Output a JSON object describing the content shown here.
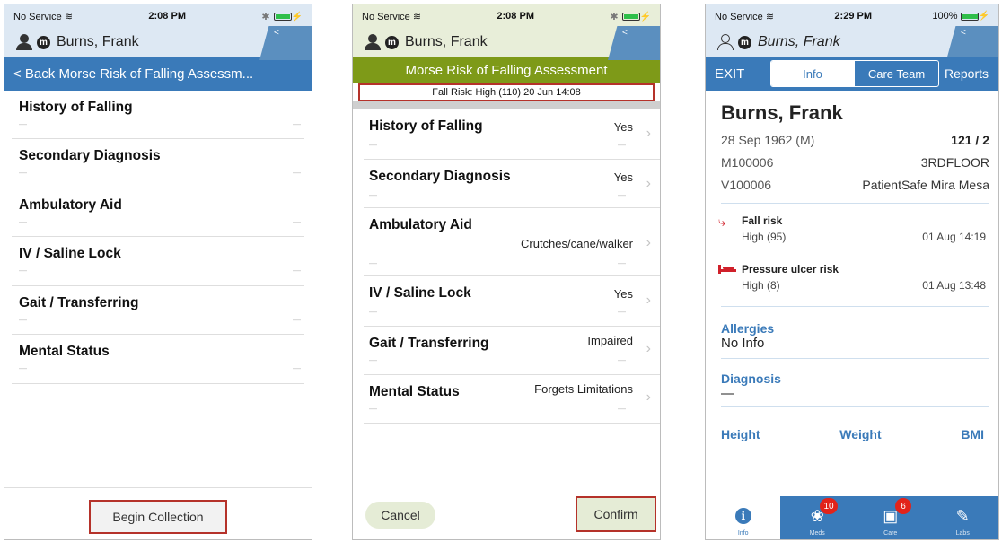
{
  "screen1": {
    "status": {
      "carrier": "No Service",
      "time": "2:08 PM"
    },
    "patient": {
      "name": "Burns, Frank",
      "badge": "m"
    },
    "nav": {
      "title": "< Back  Morse Risk of Falling Assessm..."
    },
    "rows": [
      {
        "label": "History of Falling"
      },
      {
        "label": "Secondary Diagnosis"
      },
      {
        "label": "Ambulatory Aid"
      },
      {
        "label": "IV / Saline Lock"
      },
      {
        "label": "Gait / Transferring"
      },
      {
        "label": "Mental Status"
      }
    ],
    "begin_button": "Begin Collection"
  },
  "screen2": {
    "status": {
      "carrier": "No Service",
      "time": "2:08 PM"
    },
    "patient": {
      "name": "Burns, Frank",
      "badge": "m"
    },
    "title": "Morse Risk of Falling Assessment",
    "fall_risk_banner": "Fall Risk: High (110) 20 Jun 14:08",
    "rows": [
      {
        "label": "History of Falling",
        "value": "Yes"
      },
      {
        "label": "Secondary Diagnosis",
        "value": "Yes"
      },
      {
        "label": "Ambulatory Aid",
        "value": "Crutches/cane/walker"
      },
      {
        "label": "IV / Saline Lock",
        "value": "Yes"
      },
      {
        "label": "Gait / Transferring",
        "value": "Impaired"
      },
      {
        "label": "Mental Status",
        "value": "Forgets Limitations"
      }
    ],
    "cancel_button": "Cancel",
    "confirm_button": "Confirm"
  },
  "screen3": {
    "status": {
      "carrier": "No Service",
      "time": "2:29 PM",
      "battery": "100%"
    },
    "patient": {
      "name": "Burns, Frank",
      "badge": "m"
    },
    "nav": {
      "exit": "EXIT",
      "tab_info": "Info",
      "tab_care_team": "Care Team",
      "reports": "Reports"
    },
    "patient_name": "Burns, Frank",
    "dob": "28 Sep 1962 (M)",
    "room": "121 / 2",
    "mrn": "M100006",
    "floor": "3RDFLOOR",
    "visit": "V100006",
    "facility": "PatientSafe Mira Mesa",
    "fall_risk": {
      "title": "Fall risk",
      "value": "High (95)",
      "date": "01 Aug 14:19"
    },
    "pressure_risk": {
      "title": "Pressure ulcer risk",
      "value": "High (8)",
      "date": "01 Aug 13:48"
    },
    "allergies": {
      "title": "Allergies",
      "value": "No Info"
    },
    "diagnosis": {
      "title": "Diagnosis",
      "value": "—"
    },
    "measures": {
      "height": "Height",
      "weight": "Weight",
      "bmi": "BMI"
    },
    "tabbar": {
      "info": "Info",
      "meds": "Meds",
      "meds_badge": "10",
      "care": "Care",
      "care_badge": "6",
      "labs": "Labs"
    }
  },
  "colors": {
    "nav_blue": "#3a7ab9",
    "olive": "#7e9a18",
    "highlight_red": "#b5322a",
    "risk_red": "#d0202a",
    "patient_band": "#dde8f3",
    "patient_band_green": "#e8eed9"
  }
}
